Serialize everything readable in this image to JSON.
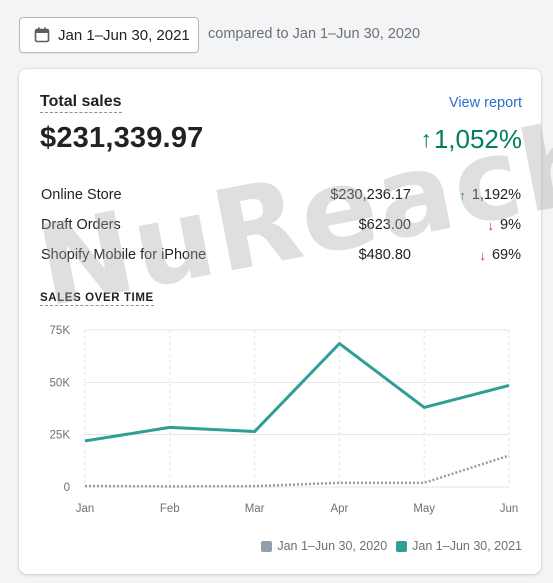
{
  "date_range_button": {
    "label": "Jan 1–Jun 30, 2021",
    "icon": "calendar-icon"
  },
  "compare_text": "compared to Jan 1–Jun 30, 2020",
  "card": {
    "title": "Total sales",
    "view_report": "View report",
    "total_value": "$231,339.97",
    "total_change": "1,052%",
    "total_change_direction": "up"
  },
  "channels": [
    {
      "name": "Online Store",
      "value": "$230,236.17",
      "change": "1,192%",
      "direction": "up"
    },
    {
      "name": "Draft Orders",
      "value": "$623.00",
      "change": "9%",
      "direction": "down"
    },
    {
      "name": "Shopify Mobile for iPhone",
      "value": "$480.80",
      "change": "69%",
      "direction": "down"
    }
  ],
  "chart_title": "SALES OVER TIME",
  "chart_data": {
    "type": "line",
    "x": [
      "Jan",
      "Feb",
      "Mar",
      "Apr",
      "May",
      "Jun"
    ],
    "yticks": [
      "0",
      "25K",
      "50K",
      "75K"
    ],
    "ylim": [
      0,
      75000
    ],
    "series": [
      {
        "name": "Jan 1–Jun 30, 2020",
        "values": [
          500,
          300,
          400,
          2000,
          2000,
          15000
        ],
        "style": "dotted",
        "color": "#919eab"
      },
      {
        "name": "Jan 1–Jun 30, 2021",
        "values": [
          22000,
          28500,
          26500,
          68500,
          38000,
          48500
        ],
        "style": "solid",
        "color": "#2e9e96"
      }
    ],
    "grid": true,
    "legend": "bottom-right"
  },
  "watermark": "NuReach",
  "colors": {
    "positive": "#007f5f",
    "negative": "#d72c0d",
    "link": "#2c6ecb"
  }
}
